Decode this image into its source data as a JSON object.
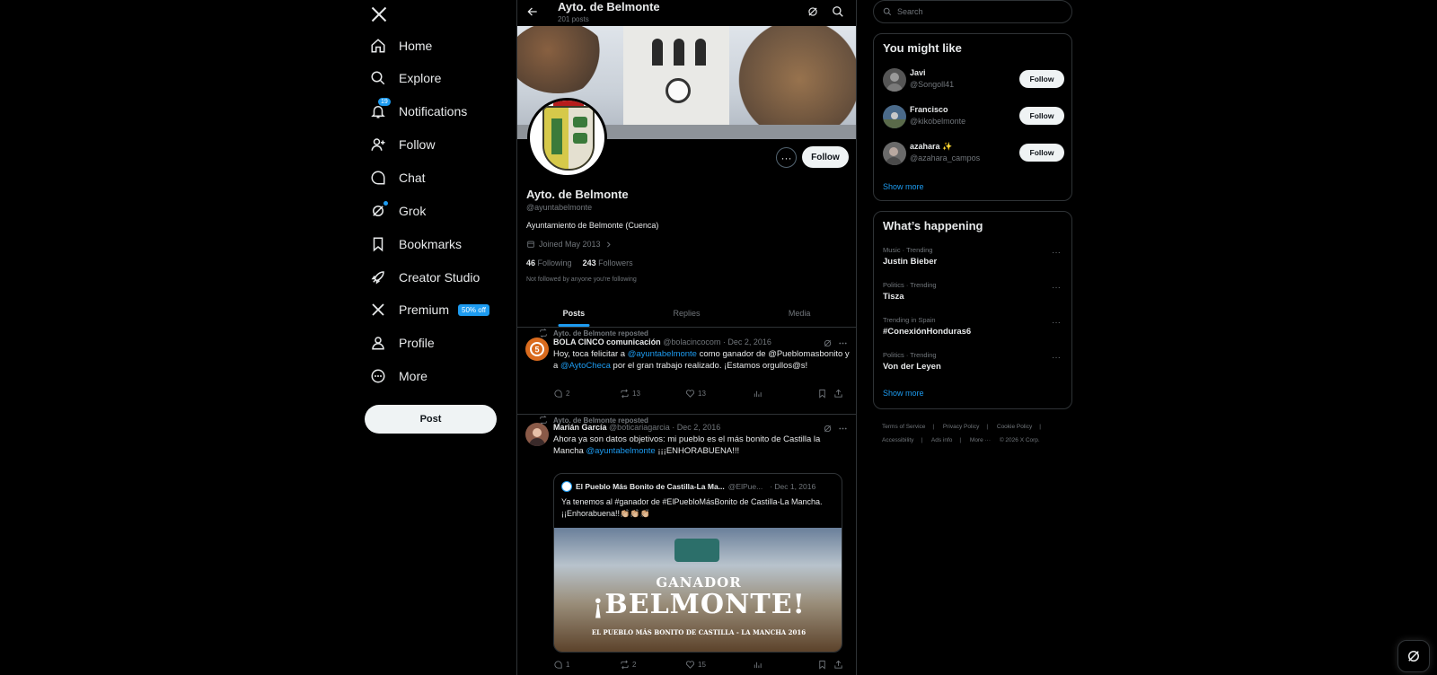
{
  "nav": {
    "items": [
      {
        "label": "Home",
        "icon": "home-icon"
      },
      {
        "label": "Explore",
        "icon": "search-icon"
      },
      {
        "label": "Notifications",
        "icon": "bell-icon",
        "badge": "19"
      },
      {
        "label": "Follow",
        "icon": "person-add-icon"
      },
      {
        "label": "Chat",
        "icon": "chat-icon"
      },
      {
        "label": "Grok",
        "icon": "grok-icon"
      },
      {
        "label": "Bookmarks",
        "icon": "bookmark-icon"
      },
      {
        "label": "Creator Studio",
        "icon": "rocket-icon"
      },
      {
        "label": "Premium",
        "icon": "x-icon",
        "promo": "50% off"
      },
      {
        "label": "Profile",
        "icon": "person-icon"
      },
      {
        "label": "More",
        "icon": "more-circle-icon"
      }
    ],
    "post_label": "Post"
  },
  "header": {
    "title": "Ayto. de Belmonte",
    "post_count": "201 posts"
  },
  "profile": {
    "name": "Ayto. de Belmonte",
    "handle": "@ayuntabelmonte",
    "bio": "Ayuntamiento de Belmonte (Cuenca)",
    "joined": "Joined May 2013",
    "following_count": "46",
    "following_label": "Following",
    "followers_count": "243",
    "followers_label": "Followers",
    "note": "Not followed by anyone you're following",
    "follow_label": "Follow",
    "more_label": "···"
  },
  "tabs": [
    "Posts",
    "Replies",
    "Media"
  ],
  "posts": [
    {
      "repost": "Ayto. de Belmonte reposted",
      "author": "BOLA CINCO comunicación",
      "handle": "@bolacincocom",
      "date": "· Dec 2, 2016",
      "text_1": "Hoy, toca felicitar a ",
      "mention_1": "@ayuntabelmonte",
      "text_2": " como ganador de @Pueblomasbonito y a ",
      "mention_2": "@AytoCheca",
      "text_3": " por el gran trabajo realizado. ¡Estamos orgullos@s!",
      "replies": "2",
      "reposts": "13",
      "likes": "13"
    },
    {
      "repost": "Ayto. de Belmonte reposted",
      "author": "Marián García",
      "handle": "@boticariagarcia",
      "date": "· Dec 2, 2016",
      "text_1": "Ahora ya son datos objetivos: mi pueblo es el más bonito de Castilla la Mancha ",
      "mention_1": "@ayuntabelmonte",
      "text_2": " ¡¡¡ENHORABUENA!!!",
      "replies": "1",
      "reposts": "2",
      "likes": "15",
      "quote": {
        "author": "El Pueblo Más Bonito de Castilla-La Ma...",
        "handle": "@ElPue...",
        "date": "· Dec 1, 2016",
        "text": "Ya tenemos al #ganador de #ElPuebloMásBonito de Castilla-La Mancha. ¡¡Enhorabuena!!👏🏼👏🏼👏🏼",
        "image_line_1": "GANADOR",
        "image_line_2": "¡BELMONTE!",
        "image_line_3": "EL PUEBLO MÁS BONITO DE CASTILLA - LA MANCHA 2016"
      }
    }
  ],
  "search": {
    "placeholder": "Search"
  },
  "suggestions": {
    "title": "You might like",
    "items": [
      {
        "name": "Javi",
        "handle": "@Songoll41"
      },
      {
        "name": "Francisco",
        "handle": "@kikobelmonte"
      },
      {
        "name": "azahara ✨",
        "handle": "@azahara_campos"
      }
    ],
    "follow_label": "Follow",
    "show_more": "Show more"
  },
  "trends": {
    "title": "What’s happening",
    "items": [
      {
        "category": "Music · Trending",
        "topic": "Justin Bieber"
      },
      {
        "category": "Politics · Trending",
        "topic": "Tisza"
      },
      {
        "category": "Trending in Spain",
        "topic": "#ConexiónHonduras6"
      },
      {
        "category": "Politics · Trending",
        "topic": "Von der Leyen"
      }
    ],
    "show_more": "Show more"
  },
  "footer": {
    "terms": "Terms of Service",
    "privacy": "Privacy Policy",
    "cookie": "Cookie Policy",
    "accessibility": "Accessibility",
    "ads": "Ads info",
    "more": "More ···",
    "copyright": "© 2026 X Corp."
  },
  "colors": {
    "accent": "#1d9bf0",
    "background": "#000000",
    "text": "#e7e9ea",
    "muted": "#71767b",
    "border": "#2f3336"
  }
}
